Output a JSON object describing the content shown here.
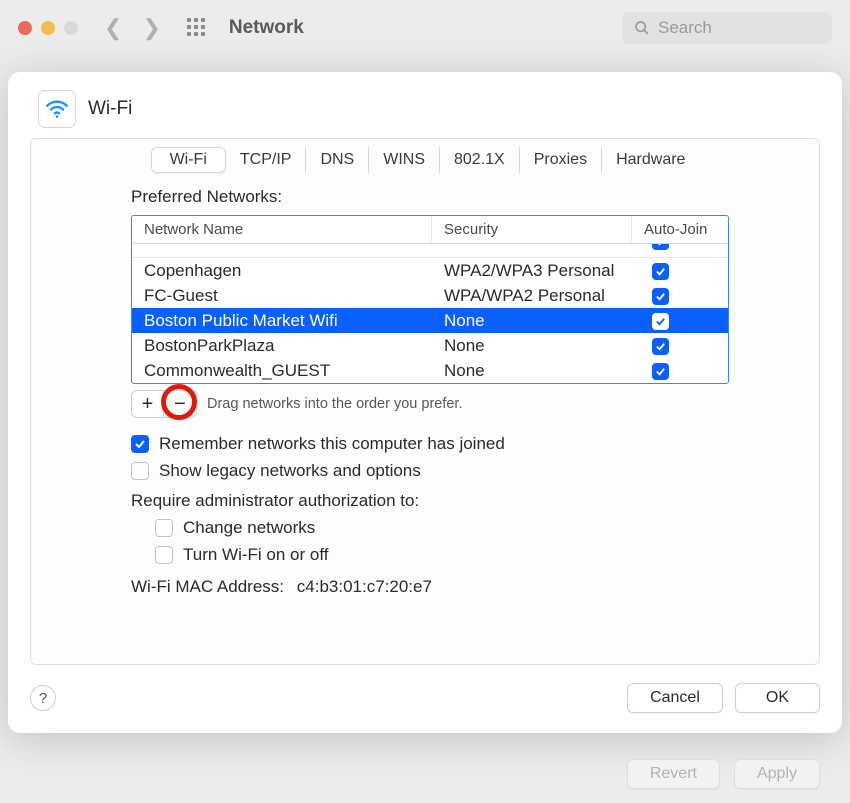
{
  "toolbar": {
    "title": "Network",
    "search_placeholder": "Search"
  },
  "sheet": {
    "title": "Wi-Fi",
    "tabs": [
      "Wi-Fi",
      "TCP/IP",
      "DNS",
      "WINS",
      "802.1X",
      "Proxies",
      "Hardware"
    ],
    "preferred_label": "Preferred Networks:",
    "columns": {
      "name": "Network Name",
      "security": "Security",
      "autojoin": "Auto-Join"
    },
    "networks": [
      {
        "name": "Copenhagen",
        "security": "WPA2/WPA3 Personal",
        "autojoin": true,
        "selected": false
      },
      {
        "name": "FC-Guest",
        "security": "WPA/WPA2 Personal",
        "autojoin": true,
        "selected": false
      },
      {
        "name": "Boston Public Market Wifi",
        "security": "None",
        "autojoin": true,
        "selected": true
      },
      {
        "name": "BostonParkPlaza",
        "security": "None",
        "autojoin": true,
        "selected": false
      },
      {
        "name": "Commonwealth_GUEST",
        "security": "None",
        "autojoin": true,
        "selected": false
      }
    ],
    "drag_hint": "Drag networks into the order you prefer.",
    "remember_label": "Remember networks this computer has joined",
    "legacy_label": "Show legacy networks and options",
    "require_admin_label": "Require administrator authorization to:",
    "change_networks_label": "Change networks",
    "turn_wifi_label": "Turn Wi-Fi on or off",
    "mac_label": "Wi-Fi MAC Address:",
    "mac_value": "c4:b3:01:c7:20:e7",
    "cancel_label": "Cancel",
    "ok_label": "OK"
  },
  "bottom": {
    "revert_label": "Revert",
    "apply_label": "Apply"
  }
}
